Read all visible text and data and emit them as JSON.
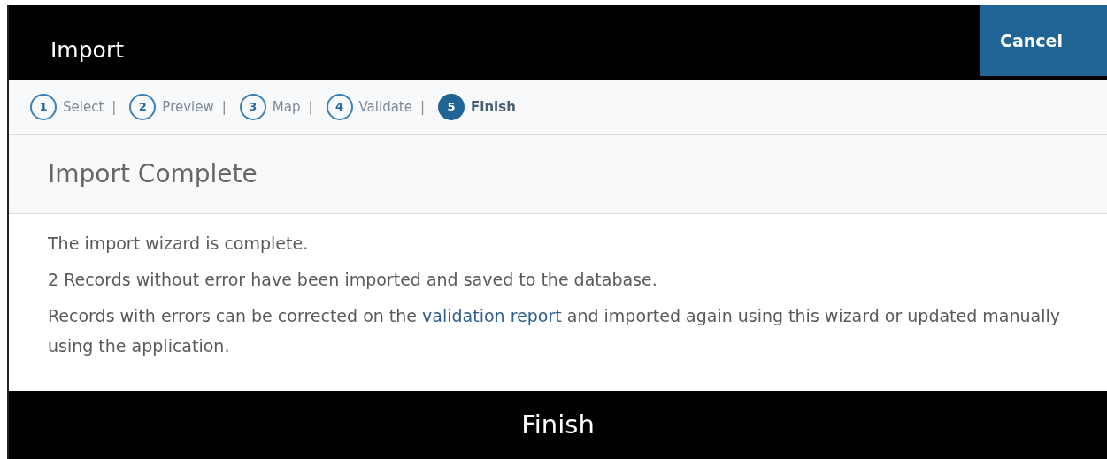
{
  "window": {
    "title": "Import"
  },
  "cancel_button": "Cancel",
  "steps": [
    {
      "number": "1",
      "label": "Select",
      "selected": false,
      "separator": "|"
    },
    {
      "number": "2",
      "label": "Preview",
      "selected": false,
      "separator": "|"
    },
    {
      "number": "3",
      "label": "Map",
      "selected": false,
      "separator": "|"
    },
    {
      "number": "4",
      "label": "Validate",
      "selected": false,
      "separator": "|"
    },
    {
      "number": "5",
      "label": "Finish",
      "selected": true
    }
  ],
  "heading": "Import Complete",
  "paragraphs": [
    {
      "kind": "text",
      "text": "The import wizard is complete."
    },
    {
      "kind": "text",
      "text": "2 Records without error have been imported and saved to the database."
    },
    {
      "kind": "link_text",
      "before": "Records with errors can be corrected on the",
      "link": "validation report",
      "after": "and imported again using this wizard or updated manually using the application."
    }
  ],
  "finish_button": "Finish"
}
